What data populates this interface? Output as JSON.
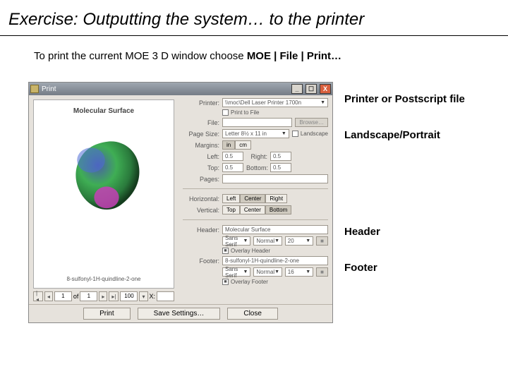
{
  "title": "Exercise: Outputting the system… to the printer",
  "intro_prefix": "To print the current MOE 3 D window choose ",
  "intro_bold": "MOE | File | Print…",
  "annotations": {
    "printer": "Printer or Postscript file",
    "orient": "Landscape/Portrait",
    "header": "Header",
    "footer": "Footer"
  },
  "window": {
    "title": "Print",
    "close": "X",
    "preview": {
      "header": "Molecular Surface",
      "footer": "8-sulfonyl-1H-quindline-2-one"
    },
    "nav": {
      "first": "|◂",
      "prev": "◂",
      "page": "1",
      "of_label": "of",
      "total": "1",
      "next": "▸",
      "last": "▸|",
      "zoom": "100",
      "x_label": "X:",
      "x": ""
    },
    "form": {
      "printer_label": "Printer:",
      "printer_value": "\\\\moc\\Dell Laser Printer 1700n",
      "print_to_file": "Print to File",
      "file_label": "File:",
      "file_value": "",
      "browse": "Browse…",
      "page_size_label": "Page Size:",
      "page_size_value": "Letter 8½ x 11 in",
      "landscape": "Landscape",
      "margins_label": "Margins:",
      "margins_unit_in": "in",
      "margins_unit_cm": "cm",
      "left_label": "Left:",
      "left": "0.5",
      "right_label": "Right:",
      "right": "0.5",
      "top_label": "Top:",
      "top": "0.5",
      "bottom_label": "Bottom:",
      "bottom": "0.5",
      "pages_label": "Pages:",
      "pages": "",
      "horiz_label": "Horizontal:",
      "horiz_left": "Left",
      "horiz_center": "Center",
      "horiz_right": "Right",
      "vert_label": "Vertical:",
      "vert_top": "Top",
      "vert_center": "Center",
      "vert_bottom": "Bottom",
      "header_label": "Header:",
      "header_value": "Molecular Surface",
      "header_font": "Sans Serif",
      "header_style": "Normal",
      "header_size": "20",
      "overlay_header": "Overlay Header",
      "footer_label": "Footer:",
      "footer_value": "8-sulfonyl-1H-quindline-2-one",
      "footer_font": "Sans Serif",
      "footer_style": "Normal",
      "footer_size": "16",
      "overlay_footer": "Overlay Footer"
    },
    "buttons": {
      "print": "Print",
      "save": "Save Settings…",
      "close": "Close"
    }
  }
}
